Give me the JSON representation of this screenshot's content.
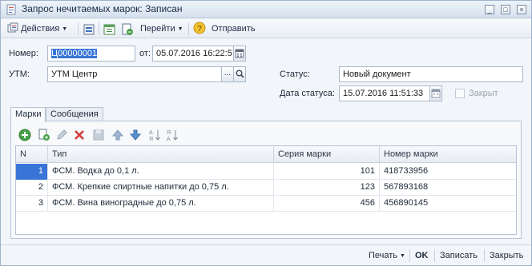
{
  "window": {
    "title": "Запрос нечитаемых марок: Записан",
    "buttons": [
      "_",
      "□",
      "×"
    ]
  },
  "toolbar": {
    "actions_label": "Действия",
    "goto_label": "Перейти",
    "send_label": "Отправить"
  },
  "form": {
    "number_label": "Номер:",
    "number_value": "Ц00000001",
    "from_label": "от:",
    "date_value": "05.07.2016 16:22:5",
    "utm_label": "УТМ:",
    "utm_value": "УТМ Центр",
    "status_label": "Статус:",
    "status_value": "Новый документ",
    "status_date_label": "Дата статуса:",
    "status_date_value": "15.07.2016 11:51:33",
    "closed_label": "Закрыт",
    "ellipsis": "...",
    "search_glyph": "🔍"
  },
  "tabs": [
    {
      "label": "Марки",
      "active": true
    },
    {
      "label": "Сообщения",
      "active": false
    }
  ],
  "table": {
    "columns": [
      "N",
      "Тип",
      "Серия марки",
      "Номер марки"
    ],
    "rows": [
      {
        "n": "1",
        "type": "ФСМ. Водка до 0,1 л.",
        "series": "101",
        "number": "418733956"
      },
      {
        "n": "2",
        "type": "ФСМ. Крепкие спиртные напитки до 0,75 л.",
        "series": "123",
        "number": "567893168"
      },
      {
        "n": "3",
        "type": "ФСМ. Вина виноградные до 0,75 л.",
        "series": "456",
        "number": "456890145"
      }
    ]
  },
  "bottom": {
    "print_label": "Печать",
    "ok_label": "OK",
    "save_label": "Записать",
    "close_label": "Закрыть"
  },
  "colors": {
    "accent": "#3875d7",
    "border": "#a9b7c8",
    "panel": "#f7f9fb"
  }
}
